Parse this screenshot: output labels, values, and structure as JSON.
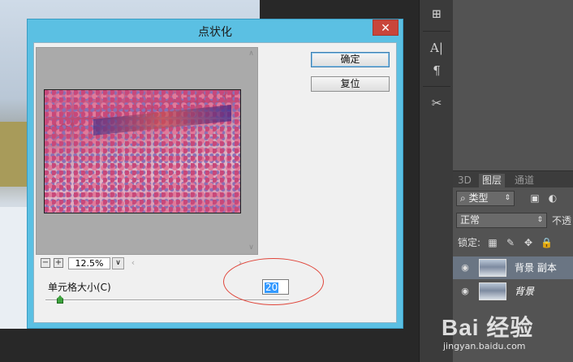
{
  "dialog": {
    "title": "点状化",
    "close_glyph": "✕",
    "ok_label": "确定",
    "reset_label": "复位",
    "zoom": {
      "minus": "−",
      "plus": "+",
      "value": "12.5%",
      "drop": "∨",
      "left": "‹",
      "right": "›"
    },
    "scroll": {
      "up": "∧",
      "down": "∨"
    },
    "cell_size": {
      "label": "单元格大小(C)",
      "value": "20",
      "min": 3,
      "max": 300
    }
  },
  "toolbar": {
    "items": [
      "⊞",
      "A|",
      "¶",
      "✂"
    ]
  },
  "layers_panel": {
    "tabs": [
      "3D",
      "图层",
      "通道"
    ],
    "active_tab": "图层",
    "kind_filter": "类型",
    "blend_mode": "正常",
    "opacity_label": "不透",
    "lock_label": "锁定:",
    "layers": [
      {
        "name": "背景 副本",
        "selected": true
      },
      {
        "name": "背景",
        "selected": false
      }
    ]
  },
  "watermark": {
    "logo": "Bai 经验",
    "url": "jingyan.baidu.com"
  },
  "colors": {
    "title_bar": "#5bc0e3",
    "close": "#c9453a",
    "annotation": "#e0463b",
    "selection": "#3399ff"
  }
}
